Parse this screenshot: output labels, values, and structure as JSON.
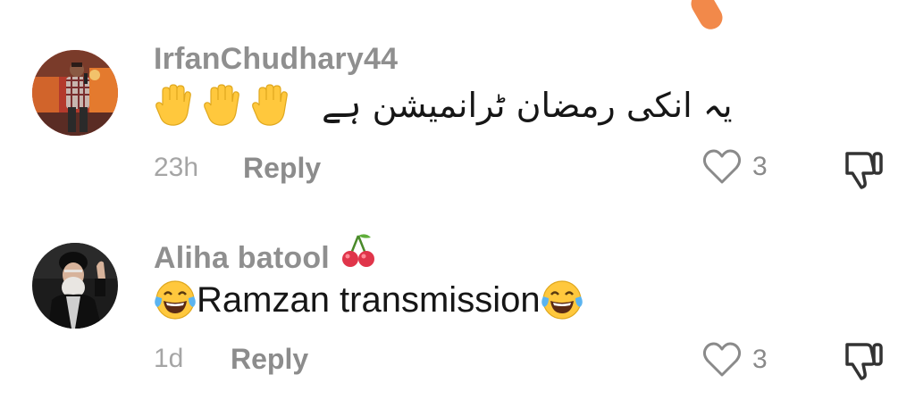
{
  "comments": [
    {
      "username": "IrfanChudhary44",
      "username_emoji": "",
      "text_emojis": [
        "waving-hand",
        "waving-hand",
        "waving-hand"
      ],
      "text": "یہ انکی رمضان ٹرانمیشن ہے",
      "time": "23h",
      "reply_label": "Reply",
      "likes": "3",
      "avatar_icon": "man-with-microphone-photo"
    },
    {
      "username": "Aliha batool",
      "username_emoji": "🍒",
      "text_prefix_emoji": "face-with-tears-of-joy",
      "text": "Ramzan transmission",
      "text_suffix_emoji": "face-with-tears-of-joy",
      "time": "1d",
      "reply_label": "Reply",
      "likes": "3",
      "avatar_icon": "cleric-portrait-photo"
    }
  ],
  "colors": {
    "username": "#8f8f8f",
    "text": "#161616",
    "meta": "#a5a5a5",
    "reply": "#8c8c8c",
    "accent_orange": "#f2894a",
    "emoji_yellow": "#ffc83d"
  }
}
